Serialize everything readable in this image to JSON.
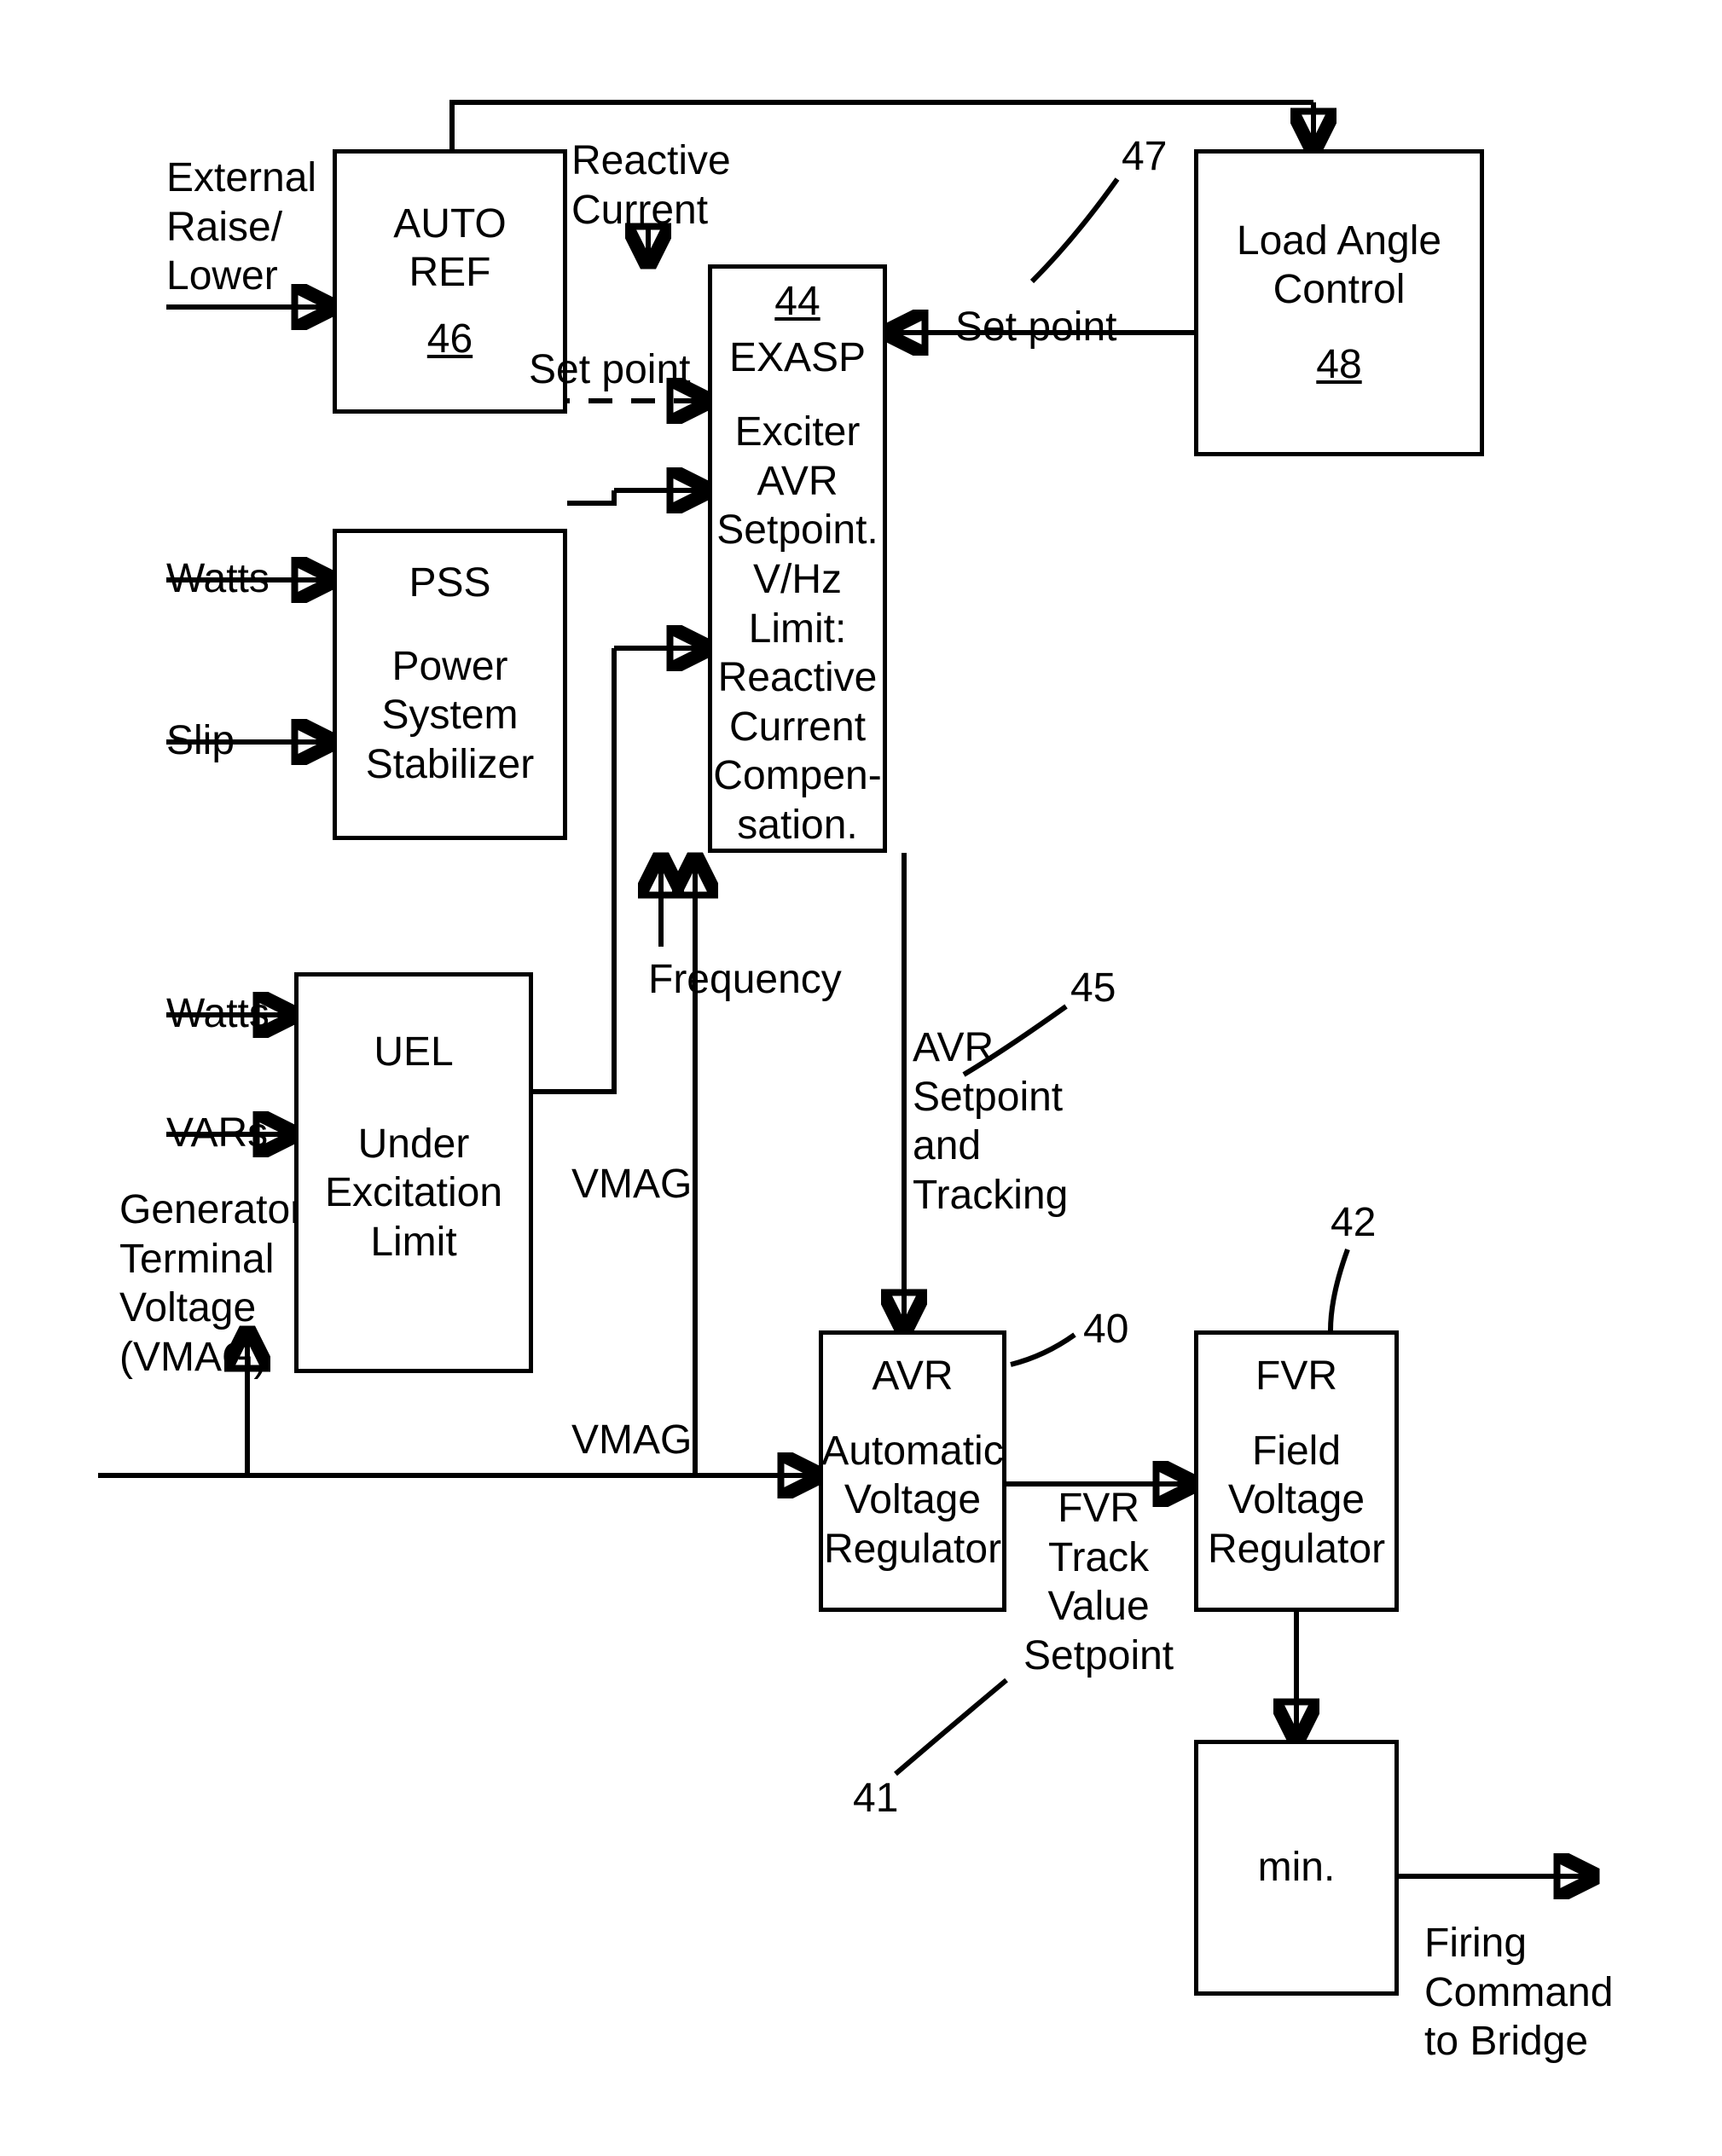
{
  "inputs": {
    "external_raise_lower": "External\nRaise/\nLower",
    "reactive_current": "Reactive\nCurrent",
    "watts_1": "Watts",
    "slip": "Slip",
    "watts_2": "Watts",
    "vars": "VARs",
    "generator_terminal_voltage": "Generator\nTerminal\nVoltage\n(VMAG)",
    "frequency": "Frequency",
    "vmag_mid": "VMAG",
    "vmag_low": "VMAG"
  },
  "blocks": {
    "auto_ref": {
      "title": "AUTO\nREF",
      "ref": "46"
    },
    "pss": {
      "title": "PSS",
      "desc": "Power\nSystem\nStabilizer"
    },
    "uel": {
      "title": "UEL",
      "desc": "Under\nExcitation\nLimit"
    },
    "exasp": {
      "ref": "44",
      "title": "EXASP",
      "desc": "Exciter AVR\nSetpoint.\nV/Hz Limit:\nReactive\nCurrent\nCompen-\nsation."
    },
    "load_angle_control": {
      "title": "Load Angle\nControl",
      "ref": "48"
    },
    "avr": {
      "title": "AVR",
      "desc": "Automatic\nVoltage\nRegulator"
    },
    "fvr": {
      "title": "FVR",
      "desc": "Field\nVoltage\nRegulator"
    },
    "min": {
      "title": "min."
    }
  },
  "signals": {
    "set_point_right": "Set point",
    "set_point_dashed": "Set point",
    "avr_setpoint_tracking": "AVR\nSetpoint\nand\nTracking",
    "fvr_track": "FVR\nTrack\nValue\nSetpoint",
    "firing_command": "Firing\nCommand\nto Bridge"
  },
  "callouts": {
    "c47": "47",
    "c45": "45",
    "c40": "40",
    "c42": "42",
    "c41": "41"
  }
}
